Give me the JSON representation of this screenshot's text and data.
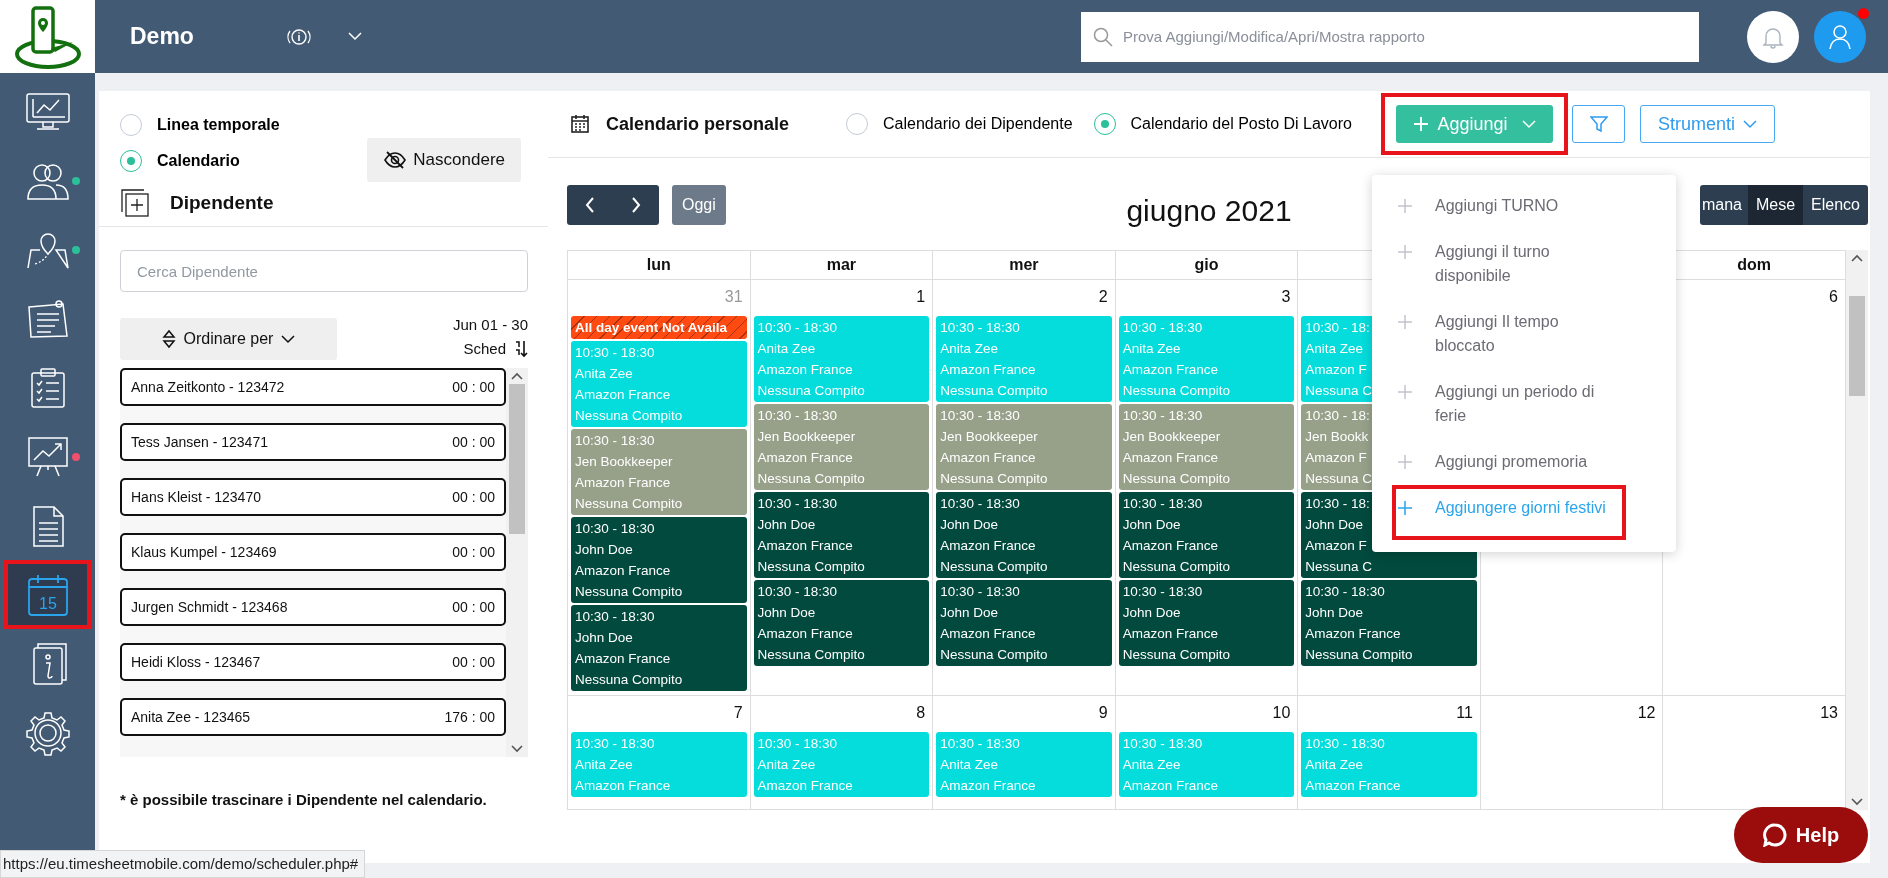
{
  "app": {
    "title": "Demo"
  },
  "search": {
    "placeholder": "Prova Aggiungi/Modifica/Apri/Mostra rapporto"
  },
  "avatar": {
    "badge": true
  },
  "sidebar": {
    "items": [
      {
        "kind": "dashboard",
        "selected": false
      },
      {
        "kind": "people",
        "selected": false,
        "color": "#2bbf9a"
      },
      {
        "kind": "map",
        "selected": false,
        "color": "#2bbf9a"
      },
      {
        "kind": "notes",
        "selected": false
      },
      {
        "kind": "checklist",
        "selected": false
      },
      {
        "kind": "chart",
        "selected": false,
        "color": "#f0506e"
      },
      {
        "kind": "document",
        "selected": false
      },
      {
        "kind": "calendar",
        "selected": true,
        "annotated": true,
        "icon_text": "15"
      },
      {
        "kind": "guide",
        "selected": false
      },
      {
        "kind": "settings",
        "selected": false
      }
    ]
  },
  "view_mode": [
    {
      "label": "Linea temporale",
      "selected": false
    },
    {
      "label": "Calendario",
      "selected": true
    }
  ],
  "hide_button": "Nascondere",
  "employees": {
    "title": "Dipendente",
    "search_placeholder": "Cerca Dipendente",
    "sort_button": "Ordinare per",
    "range": "Jun 01 - 30",
    "sort_label": "Sched",
    "items": [
      {
        "name": "Anna Zeitkonto - 123472",
        "hours": "00 : 00"
      },
      {
        "name": "Tess Jansen - 123471",
        "hours": "00 : 00"
      },
      {
        "name": "Hans Kleist - 123470",
        "hours": "00 : 00"
      },
      {
        "name": "Klaus Kumpel - 123469",
        "hours": "00 : 00"
      },
      {
        "name": "Jurgen Schmidt - 123468",
        "hours": "00 : 00"
      },
      {
        "name": "Heidi Kloss - 123467",
        "hours": "00 : 00"
      },
      {
        "name": "Anita Zee - 123465",
        "hours": "176 : 00"
      }
    ],
    "note": "* è possibile trascinare i Dipendente nel calendario."
  },
  "calendar": {
    "title": "Calendario personale",
    "sources": [
      {
        "label": "Calendario dei Dipendente",
        "selected": false
      },
      {
        "label": "Calendario del Posto Di Lavoro",
        "selected": true
      }
    ],
    "add_button": {
      "label": "Aggiungi",
      "annotated": true
    },
    "tools_button": "Strumenti",
    "today_button": "Oggi",
    "month_title": "giugno 2021",
    "views": [
      {
        "label": "mana",
        "selected": false
      },
      {
        "label": "Mese",
        "selected": true
      },
      {
        "label": "Elenco",
        "selected": false
      }
    ],
    "weekdays": {
      "before_menu": [
        "lun",
        "mar",
        "mer",
        "gio"
      ],
      "after_menu": [
        "dom"
      ]
    },
    "weeks": [
      {
        "days": [
          {
            "date": "31",
            "outside": true,
            "events": [
              {
                "kind": "unavailable",
                "color": "#ff4a12",
                "lines": [
                  "All day event Not Availa"
                ]
              },
              {
                "kind": "shift",
                "color": "#05dcdc",
                "lines": [
                  "10:30 - 18:30",
                  "Anita Zee",
                  "Amazon France",
                  "Nessuna Compito"
                ]
              },
              {
                "kind": "shift",
                "color": "#97a18a",
                "lines": [
                  "10:30 - 18:30",
                  "Jen Bookkeeper",
                  "Amazon France",
                  "Nessuna Compito"
                ]
              },
              {
                "kind": "shift",
                "color": "#024a3d",
                "lines": [
                  "10:30 - 18:30",
                  "John Doe",
                  "Amazon France",
                  "Nessuna Compito"
                ]
              },
              {
                "kind": "shift",
                "color": "#024a3d",
                "lines": [
                  "10:30 - 18:30",
                  "John Doe",
                  "Amazon France",
                  "Nessuna Compito"
                ]
              }
            ]
          },
          {
            "date": "1",
            "events": [
              {
                "kind": "shift",
                "color": "#05dcdc",
                "lines": [
                  "10:30 - 18:30",
                  "Anita Zee",
                  "Amazon France",
                  "Nessuna Compito"
                ]
              },
              {
                "kind": "shift",
                "color": "#97a18a",
                "lines": [
                  "10:30 - 18:30",
                  "Jen Bookkeeper",
                  "Amazon France",
                  "Nessuna Compito"
                ]
              },
              {
                "kind": "shift",
                "color": "#024a3d",
                "lines": [
                  "10:30 - 18:30",
                  "John Doe",
                  "Amazon France",
                  "Nessuna Compito"
                ]
              },
              {
                "kind": "shift",
                "color": "#024a3d",
                "lines": [
                  "10:30 - 18:30",
                  "John Doe",
                  "Amazon France",
                  "Nessuna Compito"
                ]
              }
            ]
          },
          {
            "date": "2",
            "events": [
              {
                "kind": "shift",
                "color": "#05dcdc",
                "lines": [
                  "10:30 - 18:30",
                  "Anita Zee",
                  "Amazon France",
                  "Nessuna Compito"
                ]
              },
              {
                "kind": "shift",
                "color": "#97a18a",
                "lines": [
                  "10:30 - 18:30",
                  "Jen Bookkeeper",
                  "Amazon France",
                  "Nessuna Compito"
                ]
              },
              {
                "kind": "shift",
                "color": "#024a3d",
                "lines": [
                  "10:30 - 18:30",
                  "John Doe",
                  "Amazon France",
                  "Nessuna Compito"
                ]
              },
              {
                "kind": "shift",
                "color": "#024a3d",
                "lines": [
                  "10:30 - 18:30",
                  "John Doe",
                  "Amazon France",
                  "Nessuna Compito"
                ]
              }
            ]
          },
          {
            "date": "3",
            "events": [
              {
                "kind": "shift",
                "color": "#05dcdc",
                "lines": [
                  "10:30 - 18:30",
                  "Anita Zee",
                  "Amazon France",
                  "Nessuna Compito"
                ]
              },
              {
                "kind": "shift",
                "color": "#97a18a",
                "lines": [
                  "10:30 - 18:30",
                  "Jen Bookkeeper",
                  "Amazon France",
                  "Nessuna Compito"
                ]
              },
              {
                "kind": "shift",
                "color": "#024a3d",
                "lines": [
                  "10:30 - 18:30",
                  "John Doe",
                  "Amazon France",
                  "Nessuna Compito"
                ]
              },
              {
                "kind": "shift",
                "color": "#024a3d",
                "lines": [
                  "10:30 - 18:30",
                  "John Doe",
                  "Amazon France",
                  "Nessuna Compito"
                ]
              }
            ]
          },
          {
            "events": [
              {
                "kind": "shift",
                "color": "#05dcdc",
                "lines": [
                  "10:30 - 18:",
                  "Anita Zee",
                  "Amazon F",
                  "Nessuna C"
                ]
              },
              {
                "kind": "shift",
                "color": "#97a18a",
                "lines": [
                  "10:30 - 18:",
                  "Jen Bookk",
                  "Amazon F",
                  "Nessuna C"
                ]
              },
              {
                "kind": "shift",
                "color": "#024a3d",
                "lines": [
                  "10:30 - 18:",
                  "John Doe",
                  "Amazon F",
                  "Nessuna C"
                ]
              },
              {
                "kind": "shift",
                "color": "#024a3d",
                "lines": [
                  "10:30 - 18:30",
                  "John Doe",
                  "Amazon France",
                  "Nessuna Compito"
                ]
              }
            ]
          }
        ],
        "after_menu": [
          {
            "date": "6"
          }
        ]
      },
      {
        "days": [
          {
            "date": "7",
            "events": [
              {
                "kind": "shift",
                "color": "#05dcdc",
                "lines": [
                  "10:30 - 18:30",
                  "Anita Zee",
                  "Amazon France"
                ]
              }
            ]
          },
          {
            "date": "8",
            "events": [
              {
                "kind": "shift",
                "color": "#05dcdc",
                "lines": [
                  "10:30 - 18:30",
                  "Anita Zee",
                  "Amazon France"
                ]
              }
            ]
          },
          {
            "date": "9",
            "events": [
              {
                "kind": "shift",
                "color": "#05dcdc",
                "lines": [
                  "10:30 - 18:30",
                  "Anita Zee",
                  "Amazon France"
                ]
              }
            ]
          },
          {
            "date": "10",
            "events": [
              {
                "kind": "shift",
                "color": "#05dcdc",
                "lines": [
                  "10:30 - 18:30",
                  "Anita Zee",
                  "Amazon France"
                ]
              }
            ]
          },
          {
            "date": "11",
            "events": [
              {
                "kind": "shift",
                "color": "#05dcdc",
                "lines": [
                  "10:30 - 18:30",
                  "Anita Zee",
                  "Amazon France"
                ]
              }
            ]
          },
          {
            "date": "12"
          },
          {
            "date": "13"
          }
        ]
      }
    ]
  },
  "add_menu": [
    {
      "label": "Aggiungi TURNO",
      "selected": false
    },
    {
      "label": "Aggiungi il turno disponibile",
      "selected": false
    },
    {
      "label": "Aggiungi Il tempo bloccato",
      "selected": false
    },
    {
      "label": "Aggiungi un periodo di ferie",
      "selected": false
    },
    {
      "label": "Aggiungi promemoria",
      "selected": false
    },
    {
      "label": "Aggiungere giorni festivi",
      "selected": true,
      "annotated": true
    }
  ],
  "help_button": "Help",
  "status_url": "https://eu.timesheetmobile.com/demo/scheduler.php#"
}
